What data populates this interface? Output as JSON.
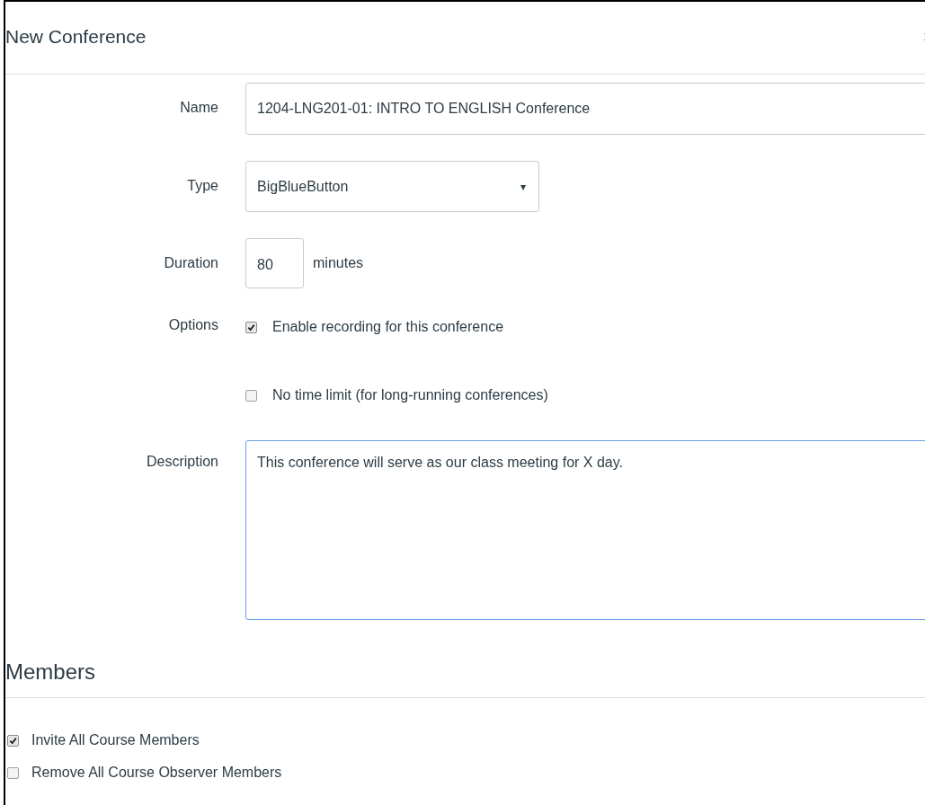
{
  "dialog": {
    "title": "New Conference"
  },
  "fields": [
    {
      "kind": "text",
      "label": "Name",
      "value": "1204-LNG201-01: INTRO TO ENGLISH Conference"
    },
    {
      "kind": "select",
      "label": "Type",
      "value": "BigBlueButton",
      "caret": "▾"
    },
    {
      "kind": "number",
      "label": "Duration",
      "value": "80",
      "unit": "minutes"
    },
    {
      "kind": "checks",
      "label": "Options",
      "options": [
        {
          "label": "Enable recording for this conference",
          "checked": true
        },
        {
          "label": "No time limit (for long-running conferences)",
          "checked": false
        }
      ]
    },
    {
      "kind": "textarea",
      "label": "Description",
      "value": "This conference will serve as our class meeting for X day."
    }
  ],
  "members": {
    "heading": "Members",
    "options": [
      {
        "label": "Invite All Course Members",
        "checked": true
      },
      {
        "label": "Remove All Course Observer Members",
        "checked": false
      }
    ]
  }
}
